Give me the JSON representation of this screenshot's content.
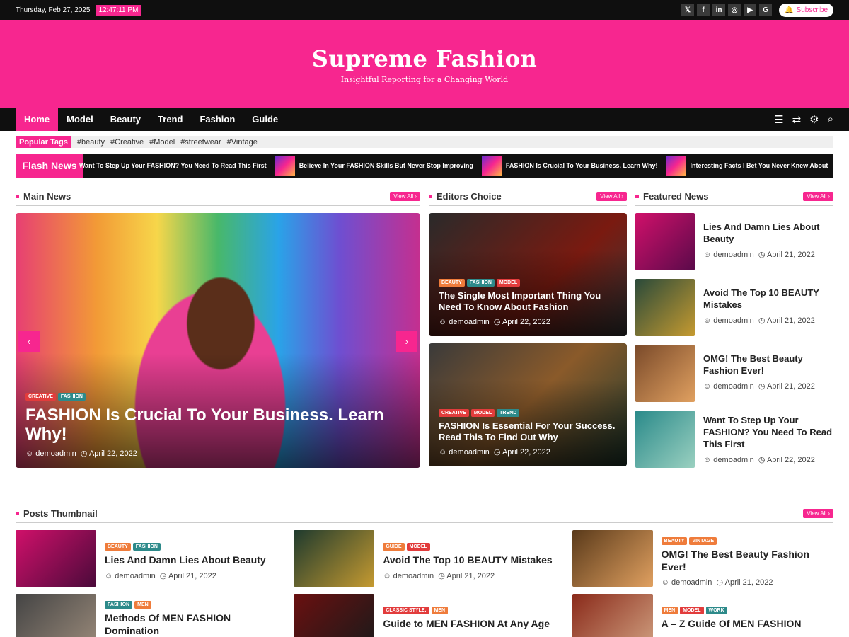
{
  "topbar": {
    "date": "Thursday, Feb 27, 2025",
    "time": "12:47:11 PM",
    "subscribe": "Subscribe",
    "social": [
      "x-icon",
      "facebook-icon",
      "linkedin-icon",
      "instagram-icon",
      "youtube-icon",
      "google-icon"
    ]
  },
  "site": {
    "title": "Supreme Fashion",
    "tagline": "Insightful Reporting for a Changing World"
  },
  "nav": {
    "items": [
      "Home",
      "Model",
      "Beauty",
      "Trend",
      "Fashion",
      "Guide"
    ],
    "active": "Home"
  },
  "tags": {
    "label": "Popular Tags",
    "items": [
      "#beauty",
      "#Creative",
      "#Model",
      "#streetwear",
      "#Vintage"
    ]
  },
  "flash": {
    "label": "Flash News",
    "items": [
      "Want To Step Up Your FASHION? You Need To Read This First",
      "Believe In Your FASHION Skills But Never Stop Improving",
      "FASHION Is Crucial To Your Business. Learn Why!",
      "Interesting Facts I Bet You Never Knew About"
    ]
  },
  "main_news": {
    "heading": "Main News",
    "view_all": "View All",
    "hero": {
      "badges": [
        "CREATIVE",
        "FASHION"
      ],
      "title": "FASHION Is Crucial To Your Business. Learn Why!",
      "author": "demoadmin",
      "date": "April 22, 2022"
    }
  },
  "editors": {
    "heading": "Editors Choice",
    "view_all": "View All",
    "cards": [
      {
        "badges": [
          "BEAUTY",
          "FASHION",
          "MODEL"
        ],
        "title": "The Single Most Important Thing You Need To Know About Fashion",
        "author": "demoadmin",
        "date": "April 22, 2022"
      },
      {
        "badges": [
          "CREATIVE",
          "MODEL",
          "TREND"
        ],
        "title": "FASHION Is Essential For Your Success. Read This To Find Out Why",
        "author": "demoadmin",
        "date": "April 22, 2022"
      }
    ]
  },
  "featured": {
    "heading": "Featured News",
    "view_all": "View All",
    "items": [
      {
        "title": "Lies And Damn Lies About Beauty",
        "author": "demoadmin",
        "date": "April 21, 2022"
      },
      {
        "title": "Avoid The Top 10 BEAUTY Mistakes",
        "author": "demoadmin",
        "date": "April 21, 2022"
      },
      {
        "title": "OMG! The Best Beauty Fashion Ever!",
        "author": "demoadmin",
        "date": "April 21, 2022"
      },
      {
        "title": "Want To Step Up Your FASHION? You Need To Read This First",
        "author": "demoadmin",
        "date": "April 22, 2022"
      }
    ]
  },
  "posts": {
    "heading": "Posts Thumbnail",
    "view_all": "View All",
    "items": [
      {
        "badges": [
          "BEAUTY",
          "FASHION"
        ],
        "title": "Lies And Damn Lies About Beauty",
        "author": "demoadmin",
        "date": "April 21, 2022"
      },
      {
        "badges": [
          "GUIDE",
          "MODEL"
        ],
        "title": "Avoid The Top 10 BEAUTY Mistakes",
        "author": "demoadmin",
        "date": "April 21, 2022"
      },
      {
        "badges": [
          "BEAUTY",
          "VINTAGE"
        ],
        "title": "OMG! The Best Beauty Fashion Ever!",
        "author": "demoadmin",
        "date": "April 21, 2022"
      },
      {
        "badges": [
          "FASHION",
          "MEN"
        ],
        "title": "Methods Of MEN FASHION Domination",
        "author": "",
        "date": ""
      },
      {
        "badges": [
          "CLASSIC STYLE.",
          "MEN"
        ],
        "title": "Guide to MEN FASHION At Any Age",
        "author": "",
        "date": ""
      },
      {
        "badges": [
          "MEN",
          "MODEL",
          "WORK"
        ],
        "title": "A – Z Guide Of MEN FASHION",
        "author": "",
        "date": ""
      }
    ]
  },
  "colors": {
    "accent": "#f7268f",
    "dark": "#0f0f0f"
  }
}
